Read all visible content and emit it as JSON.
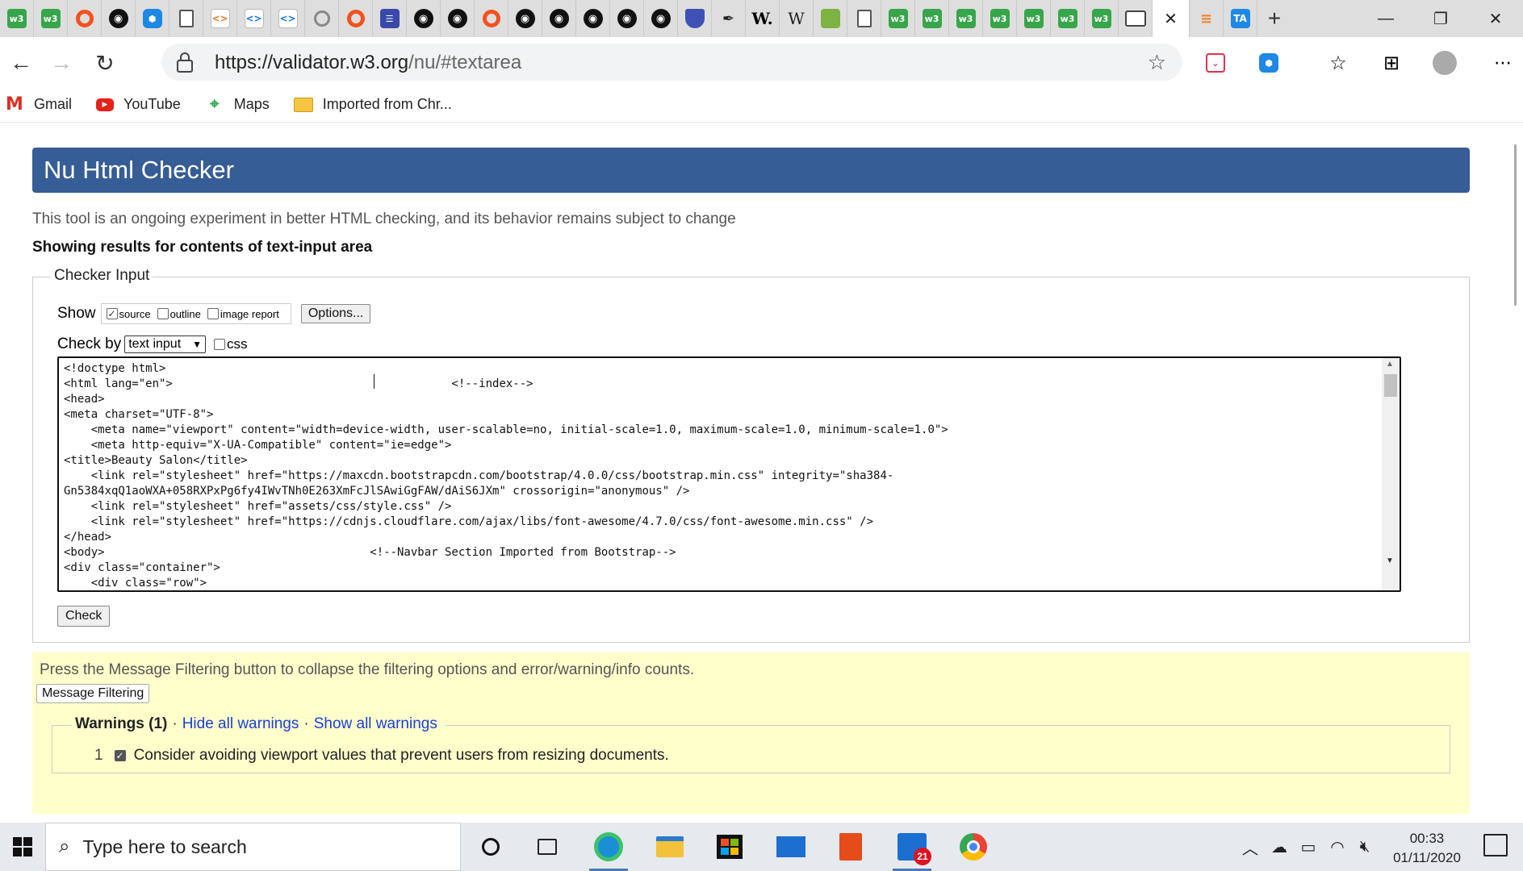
{
  "browser": {
    "tabs": [
      {
        "icon": "w3c-icon",
        "kind": "w3",
        "glyph": "w3"
      },
      {
        "icon": "w3c-icon",
        "kind": "w3",
        "glyph": "w3"
      },
      {
        "icon": "circle-icon",
        "kind": "ring",
        "glyph": ""
      },
      {
        "icon": "github-icon",
        "kind": "gh",
        "glyph": "◉"
      },
      {
        "icon": "hexagon-icon",
        "kind": "hex",
        "glyph": "⬢"
      },
      {
        "icon": "document-icon",
        "kind": "doc",
        "glyph": ""
      },
      {
        "icon": "code-icon",
        "kind": "code",
        "glyph": "<>"
      },
      {
        "icon": "code-icon",
        "kind": "code2",
        "glyph": "<>"
      },
      {
        "icon": "code-icon",
        "kind": "code2",
        "glyph": "<>"
      },
      {
        "icon": "settings-icon",
        "kind": "grey",
        "glyph": ""
      },
      {
        "icon": "circle-icon",
        "kind": "ring",
        "glyph": ""
      },
      {
        "icon": "list-icon",
        "kind": "list",
        "glyph": "☰"
      },
      {
        "icon": "github-icon",
        "kind": "gh",
        "glyph": "◉"
      },
      {
        "icon": "github-icon",
        "kind": "gh",
        "glyph": "◉"
      },
      {
        "icon": "circle-icon",
        "kind": "ring",
        "glyph": ""
      },
      {
        "icon": "github-icon",
        "kind": "gh",
        "glyph": "◉"
      },
      {
        "icon": "github-icon",
        "kind": "gh",
        "glyph": "◉"
      },
      {
        "icon": "github-icon",
        "kind": "gh",
        "glyph": "◉"
      },
      {
        "icon": "github-icon",
        "kind": "gh",
        "glyph": "◉"
      },
      {
        "icon": "github-icon",
        "kind": "gh",
        "glyph": "◉"
      },
      {
        "icon": "shield-icon",
        "kind": "shield",
        "glyph": ""
      },
      {
        "icon": "feather-icon",
        "kind": "feather",
        "glyph": "✒"
      },
      {
        "icon": "w-icon",
        "kind": "wbold",
        "glyph": "W."
      },
      {
        "icon": "wikipedia-icon",
        "kind": "wiki",
        "glyph": "W"
      },
      {
        "icon": "book-icon",
        "kind": "book",
        "glyph": ""
      },
      {
        "icon": "document-icon",
        "kind": "doc",
        "glyph": ""
      },
      {
        "icon": "w3c-icon",
        "kind": "w3",
        "glyph": "w3"
      },
      {
        "icon": "w3c-icon",
        "kind": "w3",
        "glyph": "w3"
      },
      {
        "icon": "w3c-icon",
        "kind": "w3",
        "glyph": "w3"
      },
      {
        "icon": "w3c-icon",
        "kind": "w3",
        "glyph": "w3"
      },
      {
        "icon": "w3c-icon",
        "kind": "w3",
        "glyph": "w3"
      },
      {
        "icon": "w3c-icon",
        "kind": "w3",
        "glyph": "w3"
      },
      {
        "icon": "w3c-icon",
        "kind": "w3",
        "glyph": "w3"
      },
      {
        "icon": "grid-icon",
        "kind": "grid",
        "glyph": ""
      }
    ],
    "after_tabs": [
      {
        "icon": "stackoverflow-icon",
        "kind": "so",
        "glyph": "≡"
      },
      {
        "icon": "ta-icon",
        "kind": "ta",
        "glyph": "TA"
      }
    ],
    "url_host": "https://validator.w3.org",
    "url_path": "/nu/#textarea",
    "bookmarks": [
      {
        "label": "Gmail",
        "icon": "gmail-icon"
      },
      {
        "label": "YouTube",
        "icon": "youtube-icon"
      },
      {
        "label": "Maps",
        "icon": "maps-icon"
      },
      {
        "label": "Imported from Chr...",
        "icon": "folder-icon"
      }
    ]
  },
  "page": {
    "title": "Nu Html Checker",
    "intro": "This tool is an ongoing experiment in better HTML checking, and its behavior remains subject to change",
    "showing": "Showing results for contents of text-input area",
    "checker": {
      "legend": "Checker Input",
      "show_label": "Show",
      "options": [
        {
          "label": "source",
          "checked": true
        },
        {
          "label": "outline",
          "checked": false
        },
        {
          "label": "image report",
          "checked": false
        }
      ],
      "options_button": "Options...",
      "check_by_label": "Check by",
      "check_by_value": "text input",
      "css_label": "css",
      "check_button": "Check",
      "code_lines": [
        "<!doctype html>",
        "<html lang=\"en\">                                         <!--index-->",
        "<head>",
        "<meta charset=\"UTF-8\">",
        "    <meta name=\"viewport\" content=\"width=device-width, user-scalable=no, initial-scale=1.0, maximum-scale=1.0, minimum-scale=1.0\">",
        "    <meta http-equiv=\"X-UA-Compatible\" content=\"ie=edge\">",
        "<title>Beauty Salon</title>",
        "    <link rel=\"stylesheet\" href=\"https://maxcdn.bootstrapcdn.com/bootstrap/4.0.0/css/bootstrap.min.css\" integrity=\"sha384-",
        "Gn5384xqQ1aoWXA+058RXPxPg6fy4IWvTNh0E263XmFcJlSAwiGgFAW/dAiS6JXm\" crossorigin=\"anonymous\" />",
        "    <link rel=\"stylesheet\" href=\"assets/css/style.css\" />",
        "    <link rel=\"stylesheet\" href=\"https://cdnjs.cloudflare.com/ajax/libs/font-awesome/4.7.0/css/font-awesome.min.css\" />",
        "</head>",
        "<body>                                       <!--Navbar Section Imported from Bootstrap-->",
        "<div class=\"container\">",
        "    <div class=\"row\">"
      ]
    },
    "filter": {
      "message": "Press the Message Filtering button to collapse the filtering options and error/warning/info counts.",
      "button": "Message Filtering",
      "warnings_label": "Warnings (1)",
      "hide_all": "Hide all warnings",
      "show_all": "Show all warnings",
      "items": [
        {
          "number": "1",
          "text": "Consider avoiding viewport values that prevent users from resizing documents."
        }
      ]
    }
  },
  "taskbar": {
    "search_placeholder": "Type here to search",
    "chat_badge": "21",
    "time": "00:33",
    "date": "01/11/2020"
  }
}
